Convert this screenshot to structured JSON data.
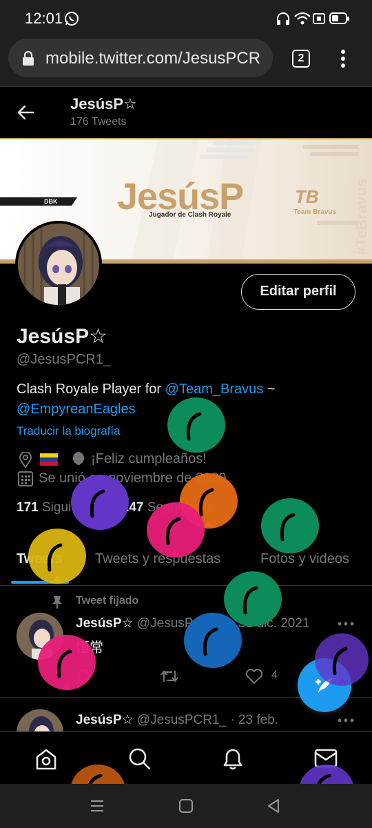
{
  "status_bar": {
    "time": "12:01"
  },
  "browser": {
    "url": "mobile.twitter.com/JesusPCR",
    "tab_count": "2"
  },
  "header": {
    "name": "JesúsP☆",
    "tweet_count": "176 Tweets"
  },
  "banner": {
    "title": "JesúsP",
    "subtitle": "Jugador de Clash Royale",
    "team": "Team Bravus",
    "team_logo": "TB",
    "sponsor": "DBK",
    "side_text": "#TeBravus"
  },
  "profile": {
    "edit_button": "Editar perfil",
    "display_name": "JesúsP☆",
    "handle": "@JesusPCR1_",
    "bio_prefix": "Clash Royale Player for ",
    "bio_mention1": "@Team_Bravus",
    "bio_suffix": " ~",
    "bio_mention2": "@EmpyreanEagles",
    "translate_bio": "Traducir la biografía",
    "birthday": "¡Feliz cumpleaños!",
    "joined": "Se unió en noviembre de 2020",
    "following_count": "171",
    "following_label": "Siguiendo",
    "followers_count": "247",
    "followers_label": "Seguidores"
  },
  "tabs": [
    "Tweets",
    "Tweets y respuestas",
    "Fotos y videos"
  ],
  "tweets": [
    {
      "pinned_label": "Tweet fijado",
      "name": "JesúsP☆",
      "handle": "@JesusPCR1_",
      "date": "· 31 dic. 2021",
      "text": "恒常",
      "likes": "4"
    },
    {
      "name": "JesúsP☆",
      "handle": "@JesusPCR1_",
      "date": "· 23 feb."
    }
  ],
  "colors": {
    "accent": "#1d9bf0",
    "background": "#000000",
    "muted": "#71767b"
  },
  "icons": [
    "back-arrow-icon",
    "lock-icon",
    "more-vert-icon",
    "location-icon",
    "venezuela-flag-icon",
    "balloon-icon",
    "calendar-icon",
    "pin-icon",
    "reply-icon",
    "retweet-icon",
    "like-icon",
    "share-icon",
    "more-horiz-icon",
    "compose-icon",
    "home-icon",
    "search-icon",
    "notifications-icon",
    "messages-icon",
    "recents-icon",
    "home-system-icon",
    "system-back-icon",
    "whatsapp-icon",
    "headphones-icon",
    "wifi-icon",
    "battery-icon"
  ]
}
